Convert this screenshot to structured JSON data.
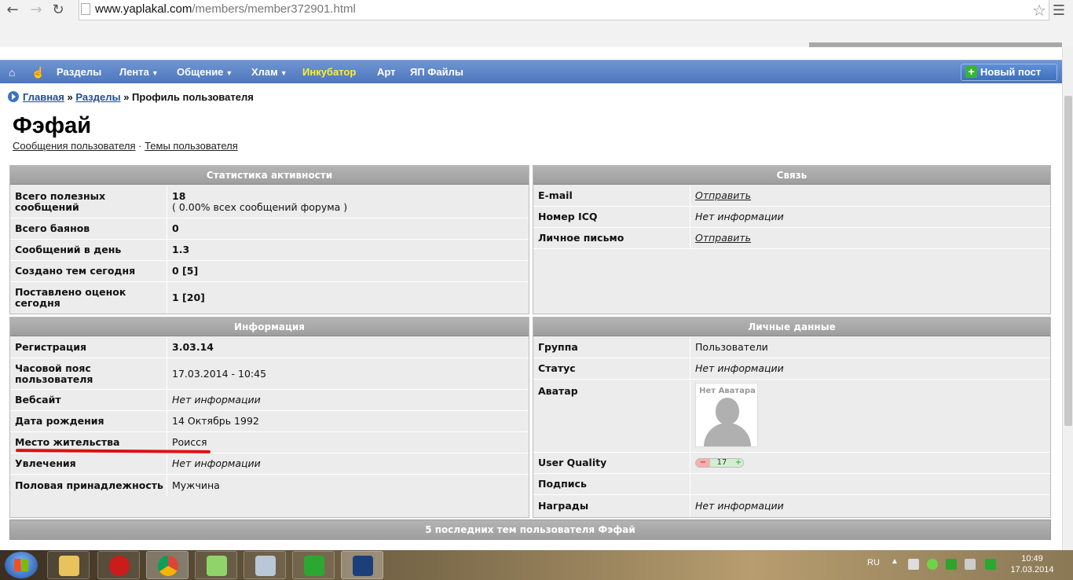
{
  "browser": {
    "url_host": "www.yaplakal.com",
    "url_path": "/members/member372901.html"
  },
  "nav": {
    "items": [
      {
        "label": "Разделы"
      },
      {
        "label": "Лента"
      },
      {
        "label": "Общение"
      },
      {
        "label": "Хлам"
      },
      {
        "label": "Инкубатор"
      },
      {
        "label": "Арт"
      },
      {
        "label": "ЯП Файлы"
      }
    ],
    "new_post": "Новый пост"
  },
  "breadcrumb": {
    "home": "Главная",
    "sep1": "»",
    "sections": "Разделы",
    "sep2": "»",
    "current": "Профиль пользователя"
  },
  "profile": {
    "name": "Фэфай",
    "link_posts": "Сообщения пользователя",
    "dot": "·",
    "link_topics": "Темы пользователя"
  },
  "stats": {
    "title": "Статистика активности",
    "rows": [
      {
        "label": "Всего полезных сообщений",
        "value": "18",
        "sub": "( 0.00% всех сообщений форума )"
      },
      {
        "label": "Всего баянов",
        "value": "0"
      },
      {
        "label": "Сообщений в день",
        "value": "1.3"
      },
      {
        "label": "Создано тем сегодня",
        "value": "0 [5]"
      },
      {
        "label": "Поставлено оценок сегодня",
        "value": "1 [20]"
      }
    ]
  },
  "contact": {
    "title": "Связь",
    "rows": [
      {
        "label": "E-mail",
        "value": "Отправить"
      },
      {
        "label": "Номер ICQ",
        "value": "Нет информации"
      },
      {
        "label": "Личное письмо",
        "value": "Отправить"
      }
    ]
  },
  "info": {
    "title": "Информация",
    "rows": [
      {
        "label": "Регистрация",
        "value": "3.03.14"
      },
      {
        "label": "Часовой пояс пользователя",
        "value": "17.03.2014 - 10:45"
      },
      {
        "label": "Вебсайт",
        "value": "Нет информации"
      },
      {
        "label": "Дата рождения",
        "value": "14 Октябрь 1992"
      },
      {
        "label": "Место жительства",
        "value": "Роисся"
      },
      {
        "label": "Увлечения",
        "value": "Нет информации"
      },
      {
        "label": "Половая принадлежность",
        "value": "Мужчина"
      }
    ]
  },
  "personal": {
    "title": "Личные данные",
    "rows": [
      {
        "label": "Группа",
        "value": "Пользователи"
      },
      {
        "label": "Статус",
        "value": "Нет информации"
      },
      {
        "label": "Аватар",
        "value": "Нет Аватара"
      },
      {
        "label": "User Quality",
        "minus": "−",
        "value": "17",
        "plus": "+"
      },
      {
        "label": "Подпись",
        "value": ""
      },
      {
        "label": "Награды",
        "value": "Нет информации"
      }
    ]
  },
  "last_topics": "5 последних тем пользователя Фэфай",
  "taskbar": {
    "lang": "RU",
    "time": "10:49",
    "date": "17.03.2014"
  }
}
